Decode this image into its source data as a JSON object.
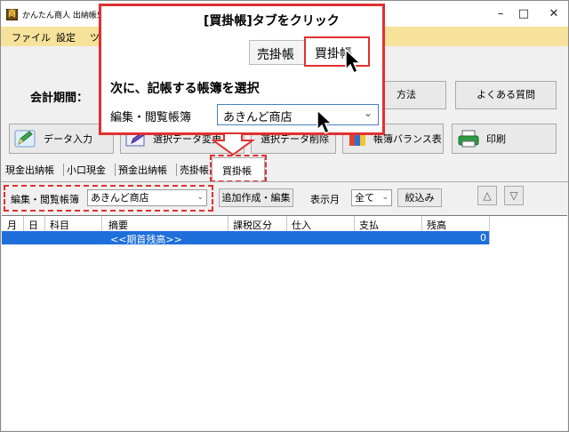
{
  "window": {
    "title": "かんたん商人 出納帳5 -",
    "minimize_glyph": "–",
    "maximize_glyph": "□",
    "close_glyph": "✕",
    "app_icon_glyph": "商"
  },
  "menu": {
    "items": [
      "ファイル",
      "設定",
      "ツ"
    ]
  },
  "period": {
    "label": "会計期間："
  },
  "right_buttons": {
    "method": "方法",
    "faq": "よくある質問"
  },
  "toolbar": {
    "data_entry": "データ入力",
    "edit_selected": "選択データ変更",
    "delete_selected": "選択データ削除",
    "balance_sheet": "帳簿バランス表",
    "print": "印刷"
  },
  "tabs": [
    "現金出納帳",
    "小口現金",
    "預金出納帳",
    "売掛帳",
    "買掛帳"
  ],
  "filter": {
    "ledger_label": "編集・閲覧帳簿",
    "ledger_value": "あきんど商店",
    "add_edit_button": "追加作成・編集",
    "month_label": "表示月",
    "month_value": "全て",
    "narrow_button": "絞込み",
    "up_glyph": "△",
    "down_glyph": "▽"
  },
  "grid": {
    "columns": [
      "月",
      "日",
      "科目",
      "摘要",
      "課税区分",
      "仕入",
      "支払",
      "残高"
    ],
    "rows": [
      {
        "description": "<<期首残高>>",
        "balance": "0"
      }
    ]
  },
  "callout": {
    "step1_title": "[買掛帳]タブをクリック",
    "tab_left": "売掛帳",
    "tab_right": "買掛帳",
    "step2_title": "次に、記帳する帳簿を選択",
    "ledger_label": "編集・閲覧帳簿",
    "ledger_value": "あきんど商店"
  },
  "colors": {
    "accent_red": "#e03030",
    "menubar": "#f7e29b",
    "selection_blue": "#1e6fd9"
  }
}
